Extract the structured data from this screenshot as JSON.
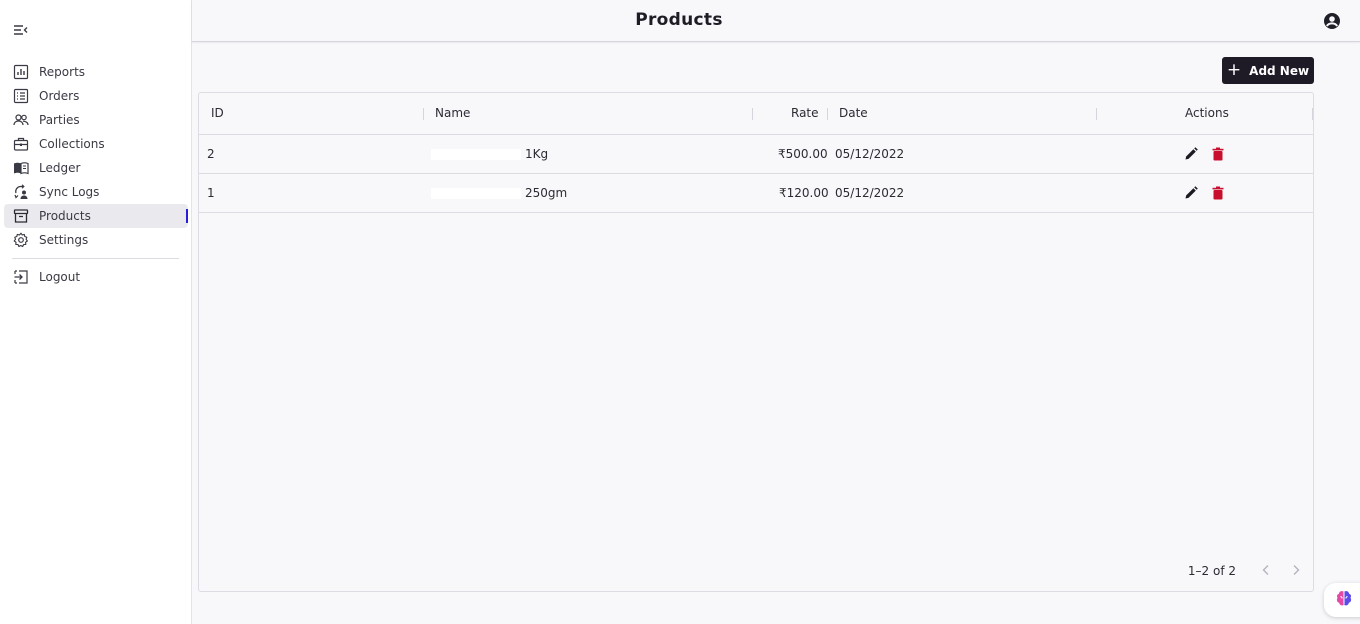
{
  "sidebar": {
    "items": [
      {
        "label": "Reports",
        "icon": "bar-chart-icon"
      },
      {
        "label": "Orders",
        "icon": "list-icon"
      },
      {
        "label": "Parties",
        "icon": "people-icon"
      },
      {
        "label": "Collections",
        "icon": "briefcase-icon"
      },
      {
        "label": "Ledger",
        "icon": "book-icon"
      },
      {
        "label": "Sync Logs",
        "icon": "sync-icon"
      },
      {
        "label": "Products",
        "icon": "archive-icon"
      },
      {
        "label": "Settings",
        "icon": "gear-icon"
      }
    ],
    "active": "Products",
    "logout_label": "Logout"
  },
  "header": {
    "title": "Products"
  },
  "toolbar": {
    "add_label": "Add New"
  },
  "table": {
    "columns": {
      "id": "ID",
      "name": "Name",
      "rate": "Rate",
      "date": "Date",
      "actions": "Actions"
    },
    "rows": [
      {
        "id": "2",
        "name": "1Kg",
        "rate": "₹500.00",
        "date": "05/12/2022"
      },
      {
        "id": "1",
        "name": "250gm",
        "rate": "₹120.00",
        "date": "05/12/2022"
      }
    ],
    "pagination": "1–2 of 2"
  },
  "colors": {
    "accent": "#2a1fd6",
    "primary_button": "#1e1a26",
    "delete": "#c8102e"
  }
}
